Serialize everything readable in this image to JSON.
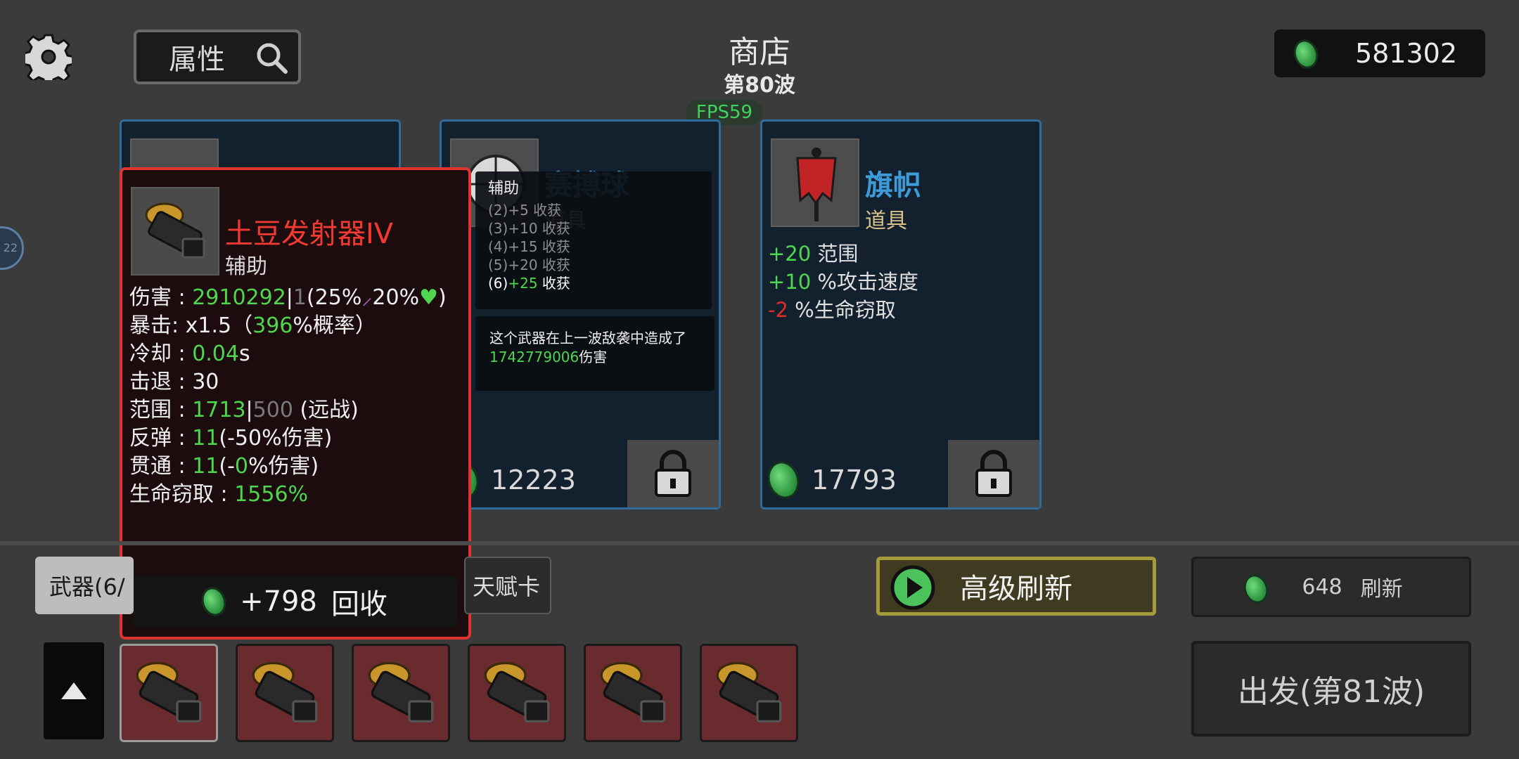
{
  "header": {
    "title": "商店",
    "wave": "第80波",
    "fps": "FPS59",
    "attribute_button": "属性",
    "money": "581302"
  },
  "side_badge": "22",
  "shop_cards": [
    {
      "name": "赛搏球",
      "type": "道具",
      "price": "12223"
    },
    {
      "name": "旗帜",
      "type": "道具",
      "price": "17793",
      "stats": [
        {
          "value": "+20",
          "label": "范围",
          "color": "green"
        },
        {
          "value": "+10",
          "label": "%攻击速度",
          "color": "green"
        },
        {
          "value": "-2",
          "label": "%生命窃取",
          "color": "red"
        }
      ]
    }
  ],
  "synergy_popup": {
    "title": "辅助",
    "tiers": [
      "(2)+5 收获",
      "(3)+10 收获",
      "(4)+15 收获",
      "(5)+20 收获"
    ],
    "active_tier_prefix": "(6)",
    "active_tier_value": "+25",
    "active_tier_label": " 收获"
  },
  "damage_popup": {
    "text_prefix": "这个武器在上一波敌袭中造成了",
    "damage_value": "1742779006",
    "text_suffix": "伤害"
  },
  "weapon_detail": {
    "name": "土豆发射器IV",
    "type": "辅助",
    "damage_label": "伤害 : ",
    "damage_value": "2910292",
    "damage_sep": "|",
    "damage_base": "1",
    "damage_pct1": "(25%",
    "damage_pct2": "20%",
    "damage_close": ")",
    "crit_label": "暴击:  x1.5（",
    "crit_value": "396",
    "crit_suffix": "%概率）",
    "cooldown_label": "冷却 : ",
    "cooldown_value": "0.04",
    "cooldown_unit": "s",
    "knockback_label": "击退 : ",
    "knockback_value": "30",
    "range_label": "范围 : ",
    "range_value": "1713",
    "range_sep": "|",
    "range_base": "500",
    "range_suffix": " (远战)",
    "bounce_label": "反弹 : ",
    "bounce_value": "11",
    "bounce_suffix": "(-50%伤害)",
    "pierce_label": "贯通 : ",
    "pierce_value": "11",
    "pierce_suffix_a": "(-",
    "pierce_zero": "0",
    "pierce_suffix_b": "%伤害)",
    "lifesteal_label": "生命窃取 : ",
    "lifesteal_value": "1556%",
    "recycle_value": "+798",
    "recycle_label": "回收"
  },
  "bottom": {
    "tab_weapons": "武器(6/",
    "tab_talent": "天赋卡",
    "advanced_refresh": "高级刷新",
    "refresh_cost": "648",
    "refresh_label": "刷新",
    "depart": "出发(第81波)"
  },
  "colors": {
    "accent_green": "#4fd64f",
    "accent_red": "#e22b2b",
    "card_border": "#2f6c9b",
    "detail_border": "#e0342f"
  }
}
